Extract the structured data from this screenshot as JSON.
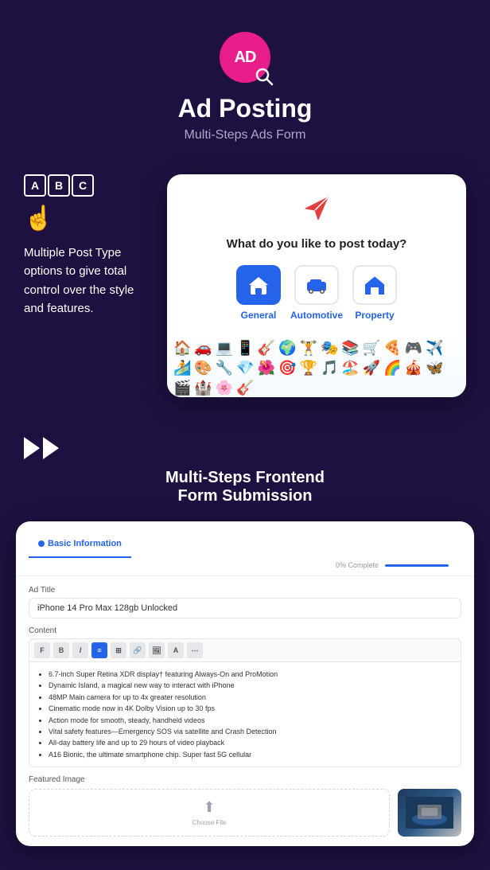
{
  "header": {
    "logo_text": "AD",
    "title": "Ad Posting",
    "subtitle": "Multi-Steps Ads Form"
  },
  "section1": {
    "description": "Multiple Post Type options to give total control over the style and features.",
    "card": {
      "question": "What do you like to post today?",
      "post_types": [
        {
          "label": "General",
          "active": true
        },
        {
          "label": "Automotive",
          "active": false
        },
        {
          "label": "Property",
          "active": false
        }
      ]
    }
  },
  "section2": {
    "title": "Multi-Steps Frontend\nForm Submission",
    "form": {
      "tab_label": "Basic Information",
      "progress_label": "0% Complete",
      "ad_title_label": "Ad Title",
      "ad_title_value": "iPhone 14 Pro Max 128gb Unlocked",
      "content_label": "Content",
      "content_items": [
        "6.7-inch Super Retina XDR display† featuring Always-On and ProMotion",
        "Dynamic Island, a magical new way to interact with iPhone",
        "48MP Main camera for up to 4x greater resolution",
        "Cinematic mode now in 4K Dolby Vision up to 30 fps",
        "Action mode for smooth, steady, handheld videos",
        "Vital safety features—Emergency SOS via satellite and Crash Detection",
        "All-day battery life and up to 29 hours of video playback",
        "A16 Bionic, the ultimate smartphone chip. Super fast 5G cellular"
      ],
      "featured_image_label": "Featured Image",
      "upload_text": "Choose File"
    }
  },
  "emojis": [
    "🏠",
    "🚗",
    "💻",
    "📱",
    "🎸",
    "🌍",
    "🏋️",
    "🎭",
    "📚",
    "🛒",
    "🍕",
    "🎮",
    "✈️",
    "🏄",
    "🎨",
    "🔧",
    "💎",
    "🌺",
    "🎯",
    "🏆",
    "🎵",
    "🏖️",
    "🚀",
    "🌈",
    "🎪",
    "🦋",
    "🎬",
    "🏰",
    "🌸",
    "🎸"
  ]
}
